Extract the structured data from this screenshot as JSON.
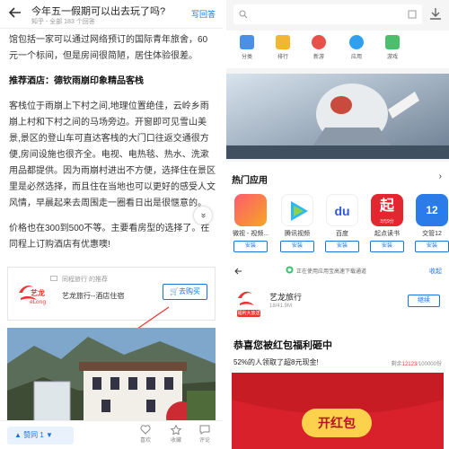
{
  "left": {
    "question_title": "今年五一假期可以出去玩了吗?",
    "question_meta": "知乎 - 全部 183 个回答",
    "write_answer": "写回答",
    "paragraph1": "馆包括一家可以通过网络预订的国际青年旅舍，60元一个标间，但是房间很简陋，居住体验很差。",
    "heading": "推荐酒店：德钦雨崩印象精品客栈",
    "paragraph2": "客栈位于雨崩上下村之间,地理位置绝佳，云岭乡雨崩上村和下村之间的马场旁边。开窗即可见雪山美景,景区的登山车可直达客栈的大门口往返交通很方便,房间设施也很齐全。电视、电热毯、热水、洗漱用品都提供。因为雨崩村进出不方便，选择住在景区里是必然选择，而且住在当地也可以更好的感受人文风情，早晨起来去周围走一圈看日出是很惬意的。",
    "paragraph3": "价格也在300到500不等。主要看房型的选择了。在同程上订购酒店有优惠噢!",
    "fold_glyph": "»",
    "ad": {
      "source": "同程旅行 的推荐",
      "logo_text_cn": "艺龙",
      "logo_text_en": "eLong",
      "name": "艺龙旅行--酒店住宿",
      "buy_label": "去购买"
    },
    "footer": {
      "like_label": "赞同 1",
      "like_arrow": "▼",
      "btn1": "喜欢",
      "btn2": "收藏",
      "btn3": "评论"
    }
  },
  "right_top": {
    "categories": [
      "分类",
      "排行",
      "新游",
      "应用",
      "游戏"
    ],
    "hot_title": "热门应用",
    "hot_arrow": "›",
    "apps": [
      {
        "name": "微视 - 视频...",
        "button": "安装"
      },
      {
        "name": "腾讯视频",
        "button": "安装"
      },
      {
        "name": "百度",
        "button": "安装"
      },
      {
        "name": "起点读书",
        "button": "安装"
      },
      {
        "name": "交管12",
        "button": "安装"
      }
    ],
    "app4_icon_text": "起",
    "app4_icon_sub": "3元9分",
    "app2_icon_text": "du",
    "app5_icon_text": "12"
  },
  "right_bottom": {
    "note": "正在使用应用宝高速下载通道",
    "close": "收起",
    "app_name": "艺龙旅行",
    "app_size": "18/41.9M",
    "badge": "福利大放送",
    "go_label": "继续",
    "congrats": "恭喜您被红包福利砸中",
    "stat": "52%的人领取了超8元现金!",
    "remain_prefix": "剩余",
    "remain_value": "12123",
    "remain_suffix": "/100000份",
    "open_label": "开红包"
  },
  "colors": {
    "accent": "#1a73d9",
    "red": "#d9212b",
    "gold": "#fcd14b"
  }
}
